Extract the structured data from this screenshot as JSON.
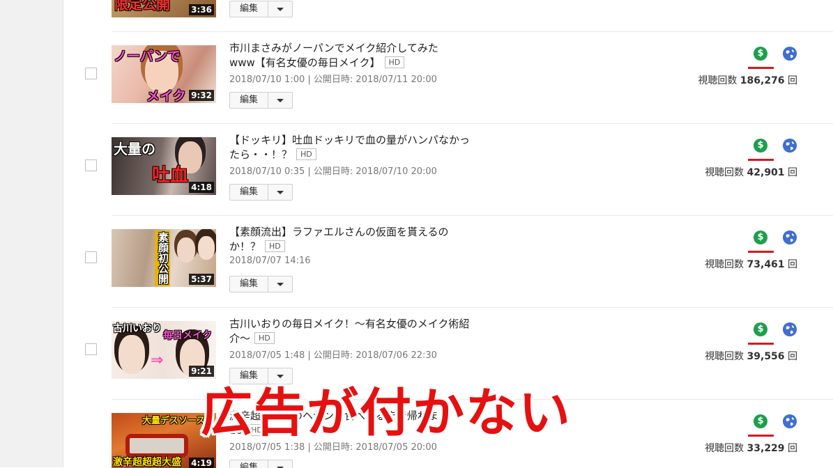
{
  "rows": [
    {
      "title_line1": "",
      "title_line2": "",
      "hd": "",
      "meta": "",
      "edit_label": "編集",
      "duration": "3:36",
      "thumb_text_1": "限定公開",
      "thumb_text_2": "",
      "views_label": "",
      "views_count": "",
      "views_unit": ""
    },
    {
      "title_line1": "市川まさみがノーパンでメイク紹介してみた",
      "title_line2": "www【有名女優の毎日メイク】",
      "hd": "HD",
      "meta": "2018/07/10 1:00 | 公開日時: 2018/07/11 20:00",
      "edit_label": "編集",
      "duration": "9:32",
      "thumb_text_1": "ノーパンで",
      "thumb_text_2": "メイク",
      "views_label": "視聴回数",
      "views_count": "186,276",
      "views_unit": "回"
    },
    {
      "title_line1": "【ドッキリ】吐血ドッキリで血の量がハンパなかっ",
      "title_line2": "たら・・！？",
      "hd": "HD",
      "meta": "2018/07/10 0:35 | 公開日時: 2018/07/10 20:00",
      "edit_label": "編集",
      "duration": "4:18",
      "thumb_text_1": "大量の",
      "thumb_text_2": "吐血",
      "views_label": "視聴回数",
      "views_count": "42,901",
      "views_unit": "回"
    },
    {
      "title_line1": "【素顔流出】ラファエルさんの仮面を貰えるの",
      "title_line2": "か！？",
      "hd": "HD",
      "meta": "2018/07/07 14:16",
      "edit_label": "編集",
      "duration": "5:37",
      "thumb_text_1": "素顔初公開",
      "thumb_text_2": "",
      "views_label": "視聴回数",
      "views_count": "73,461",
      "views_unit": "回"
    },
    {
      "title_line1": "古川いおりの毎日メイク！～有名女優のメイク術紹",
      "title_line2": "介～",
      "hd": "HD",
      "meta": "2018/07/05 1:48 | 公開日時: 2018/07/06 22:30",
      "edit_label": "編集",
      "duration": "9:21",
      "thumb_text_1": "古川いおり",
      "thumb_text_2": "毎日メイク",
      "views_label": "視聴回数",
      "views_count": "39,556",
      "views_unit": "回"
    },
    {
      "title_line1": "激辛超超大量のヘヤンを食べきるまで帰れま",
      "title_line2": "10",
      "hd": "HD",
      "meta": "2018/07/05 1:38 | 公開日時: 2018/07/05 20:00",
      "edit_label": "編集",
      "duration": "4:19",
      "thumb_text_1": "大量デスソース",
      "thumb_text_2": "激辛超超超大盛",
      "views_label": "視聴回数",
      "views_count": "33,229",
      "views_unit": "回"
    }
  ],
  "overlay_caption": "広告が付かない",
  "icons": {
    "monetization": "dollar-icon",
    "visibility": "globe-icon",
    "dropdown": "caret-down-icon"
  },
  "colors": {
    "monetization_green": "#1e9e4d",
    "underline_red": "#d61a1a",
    "caption_red": "#e61010",
    "globe_blue": "#3f6fcf"
  }
}
